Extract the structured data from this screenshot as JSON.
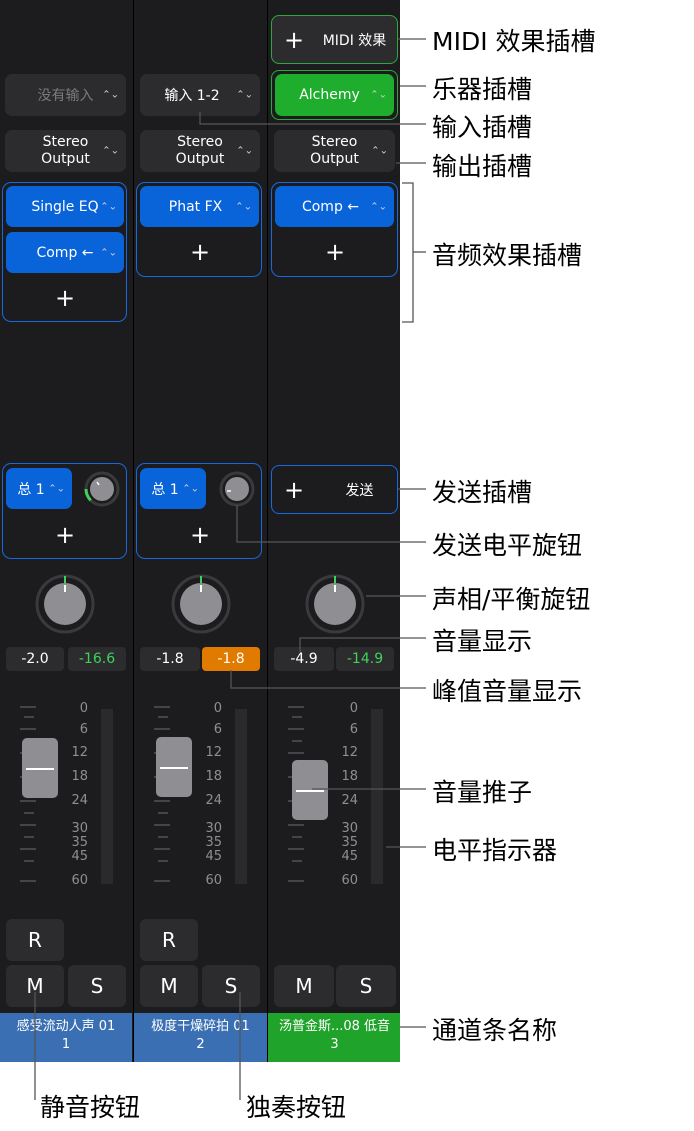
{
  "strips": [
    {
      "input": "没有输入",
      "output_line1": "Stereo",
      "output_line2": "Output",
      "effects": [
        "Single EQ",
        "Comp ←"
      ],
      "send": "总 1",
      "volume": "-2.0",
      "peak": "-16.6",
      "r_label": "R",
      "m_label": "M",
      "s_label": "S",
      "name_line1": "感受流动人声 01",
      "name_line2": "1"
    },
    {
      "input": "输入 1-2",
      "output_line1": "Stereo",
      "output_line2": "Output",
      "effects": [
        "Phat FX"
      ],
      "send": "总 1",
      "volume": "-1.8",
      "peak": "-1.8",
      "r_label": "R",
      "m_label": "M",
      "s_label": "S",
      "name_line1": "极度干燥碎拍 01",
      "name_line2": "2"
    },
    {
      "midi_fx": "MIDI 效果",
      "instrument": "Alchemy",
      "output_line1": "Stereo",
      "output_line2": "Output",
      "effects": [
        "Comp ←"
      ],
      "send": "发送",
      "volume": "-4.9",
      "peak": "-14.9",
      "m_label": "M",
      "s_label": "S",
      "name_line1": "汤普金斯...08 低音",
      "name_line2": "3"
    }
  ],
  "scale_ticks": [
    "0",
    "6",
    "12",
    "18",
    "24",
    "30",
    "35",
    "45",
    "60"
  ],
  "plus_glyph": "+",
  "callouts": {
    "midi_fx_slot": "MIDI 效果插槽",
    "instrument_slot": "乐器插槽",
    "input_slot": "输入插槽",
    "output_slot": "输出插槽",
    "audio_fx_slot": "音频效果插槽",
    "send_slot": "发送插槽",
    "send_level_knob": "发送电平旋钮",
    "pan_knob": "声相/平衡旋钮",
    "volume_display": "音量显示",
    "peak_display": "峰值音量显示",
    "volume_fader": "音量推子",
    "level_meter": "电平指示器",
    "strip_name": "通道条名称",
    "mute_button": "静音按钮",
    "solo_button": "独奏按钮"
  },
  "colors": {
    "panel_bg": "#1c1c1e",
    "slot_bg": "#2c2c2e",
    "blue": "#0a64d9",
    "green": "#1fad2e",
    "orange": "#e07b00",
    "strip_name_blue": "#3a6fb3",
    "strip_name_green": "#1fa32a"
  }
}
